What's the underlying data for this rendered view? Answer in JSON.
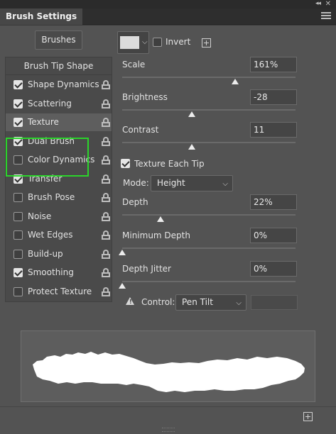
{
  "panel": {
    "title": "Brush Settings"
  },
  "brushes_button": "Brushes",
  "left_list": {
    "tip_shape": "Brush Tip Shape",
    "items": [
      {
        "label": "Shape Dynamics",
        "checked": true
      },
      {
        "label": "Scattering",
        "checked": true
      },
      {
        "label": "Texture",
        "checked": true,
        "selected": true
      },
      {
        "label": "Dual Brush",
        "checked": true
      },
      {
        "label": "Color Dynamics",
        "checked": false
      },
      {
        "label": "Transfer",
        "checked": true
      },
      {
        "label": "Brush Pose",
        "checked": false
      },
      {
        "label": "Noise",
        "checked": false
      },
      {
        "label": "Wet Edges",
        "checked": false
      },
      {
        "label": "Build-up",
        "checked": false
      },
      {
        "label": "Smoothing",
        "checked": true
      },
      {
        "label": "Protect Texture",
        "checked": false
      }
    ]
  },
  "texture": {
    "invert_label": "Invert",
    "invert_checked": false,
    "scale": {
      "label": "Scale",
      "value": "161%",
      "level": 0.65
    },
    "brightness": {
      "label": "Brightness",
      "value": "-28",
      "level": 0.4
    },
    "contrast": {
      "label": "Contrast",
      "value": "11",
      "level": 0.4
    },
    "each_tip": {
      "label": "Texture Each Tip",
      "checked": true
    },
    "mode": {
      "label": "Mode:",
      "value": "Height"
    },
    "depth": {
      "label": "Depth",
      "value": "22%",
      "level": 0.22
    },
    "min_depth": {
      "label": "Minimum Depth",
      "value": "0%",
      "level": 0
    },
    "depth_jitter": {
      "label": "Depth Jitter",
      "value": "0%",
      "level": 0
    },
    "control": {
      "label": "Control:",
      "value": "Pen Tilt"
    }
  },
  "colors": {
    "panel_bg": "#535353",
    "highlight": "#2bd42b",
    "stroke": "#ffffff"
  }
}
